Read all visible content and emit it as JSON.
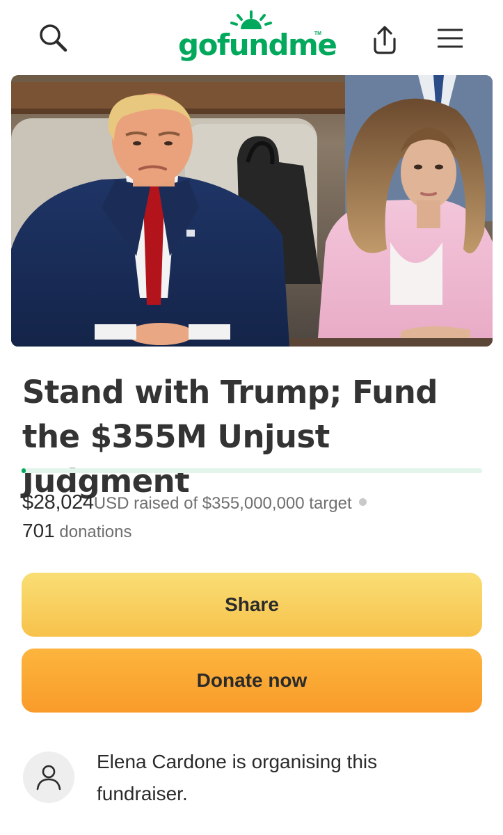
{
  "header": {
    "logo_text": "gofundme",
    "logo_tm": "TM",
    "icons": {
      "search": "search-icon",
      "share": "share-upload-icon",
      "menu": "hamburger-menu-icon"
    },
    "brand_color": "#02a95c"
  },
  "campaign": {
    "title": "Stand with Trump; Fund the $355M Unjust Judgment",
    "raised_amount": "$28,024",
    "raised_suffix": "USD raised of $355,000,000 target",
    "donation_count": "701",
    "donation_label": "donations",
    "progress_fraction": 7.89e-05
  },
  "actions": {
    "share_label": "Share",
    "donate_label": "Donate now"
  },
  "organiser": {
    "text": "Elena Cardone is organising this fundraiser.",
    "avatar_icon": "user-icon"
  }
}
